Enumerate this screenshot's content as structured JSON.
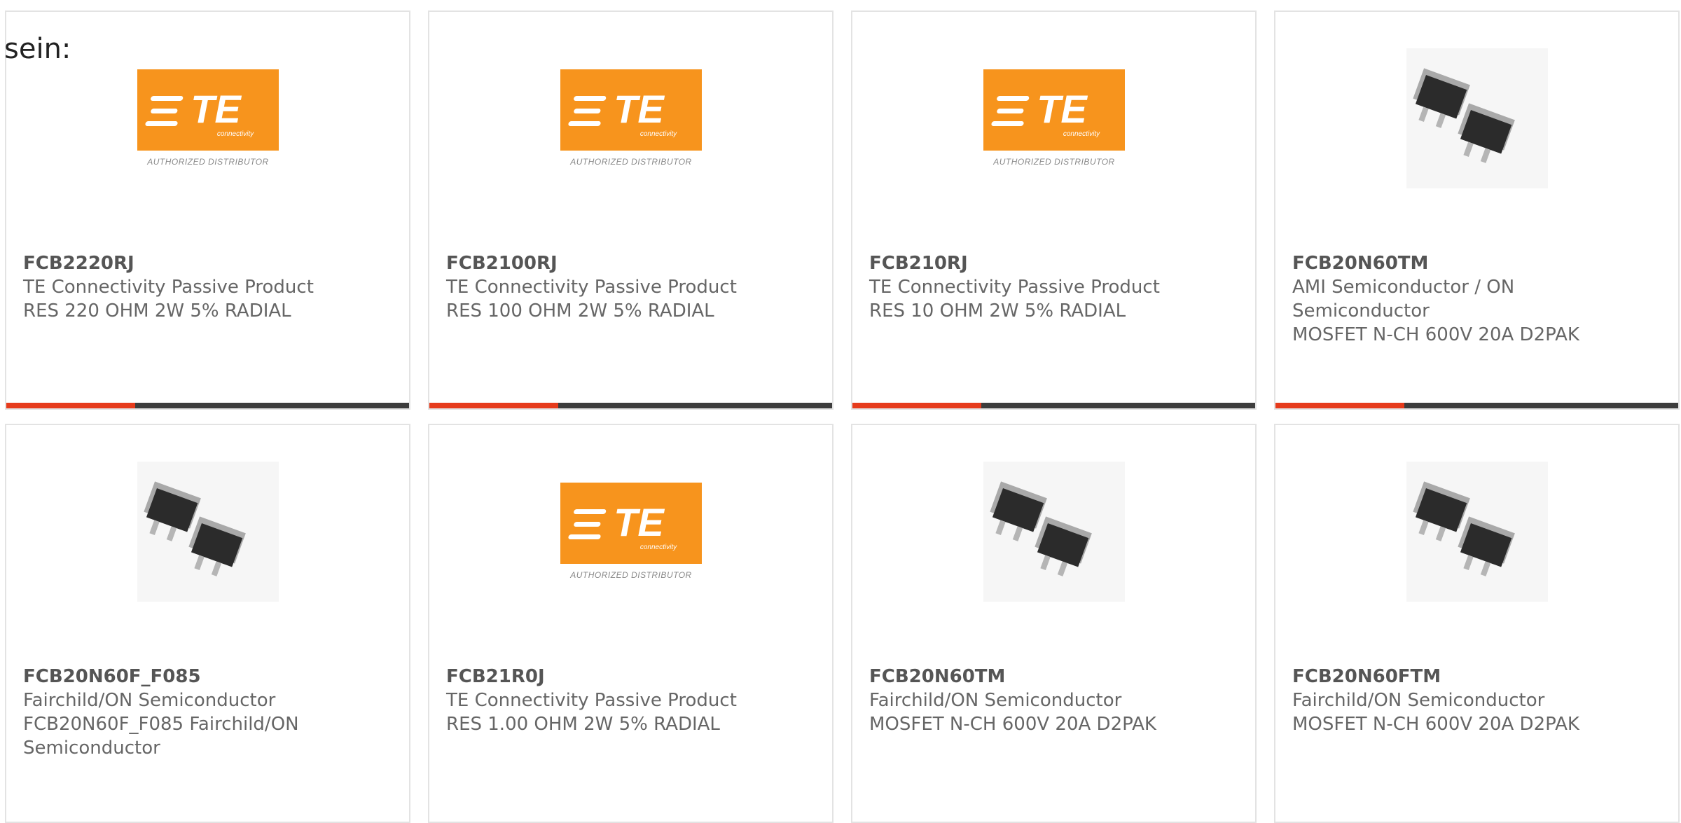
{
  "intro": "sein:",
  "colors": {
    "bar": "#3d3d3d",
    "accent": "#e63b1c",
    "te_orange": "#f7941d"
  },
  "te_logo": {
    "text": "TE",
    "subtext": "connectivity",
    "caption": "AUTHORIZED DISTRIBUTOR"
  },
  "cards": [
    {
      "part": "FCB2220RJ",
      "line1": "TE Connectivity Passive Product",
      "line2": "RES 220 OHM 2W 5% RADIAL",
      "line3": "",
      "image": "te-logo",
      "progress": 0.32
    },
    {
      "part": "FCB2100RJ",
      "line1": "TE Connectivity Passive Product",
      "line2": "RES 100 OHM 2W 5% RADIAL",
      "line3": "",
      "image": "te-logo",
      "progress": 0.32
    },
    {
      "part": "FCB210RJ",
      "line1": "TE Connectivity Passive Product",
      "line2": "RES 10 OHM 2W 5% RADIAL",
      "line3": "",
      "image": "te-logo",
      "progress": 0.32
    },
    {
      "part": "FCB20N60TM",
      "line1": "AMI Semiconductor / ON",
      "line2": "Semiconductor",
      "line3": "MOSFET N-CH 600V 20A D2PAK",
      "image": "d2pak-chip",
      "progress": 0.32
    },
    {
      "part": "FCB20N60F_F085",
      "line1": "Fairchild/ON Semiconductor",
      "line2": "FCB20N60F_F085 Fairchild/ON",
      "line3": "Semiconductor",
      "image": "d2pak-chip",
      "progress": 0
    },
    {
      "part": "FCB21R0J",
      "line1": "TE Connectivity Passive Product",
      "line2": "RES 1.00 OHM 2W 5% RADIAL",
      "line3": "",
      "image": "te-logo",
      "progress": 0
    },
    {
      "part": "FCB20N60TM",
      "line1": "Fairchild/ON Semiconductor",
      "line2": "MOSFET N-CH 600V 20A D2PAK",
      "line3": "",
      "image": "d2pak-chip",
      "progress": 0
    },
    {
      "part": "FCB20N60FTM",
      "line1": "Fairchild/ON Semiconductor",
      "line2": "MOSFET N-CH 600V 20A D2PAK",
      "line3": "",
      "image": "d2pak-chip",
      "progress": 0
    }
  ]
}
